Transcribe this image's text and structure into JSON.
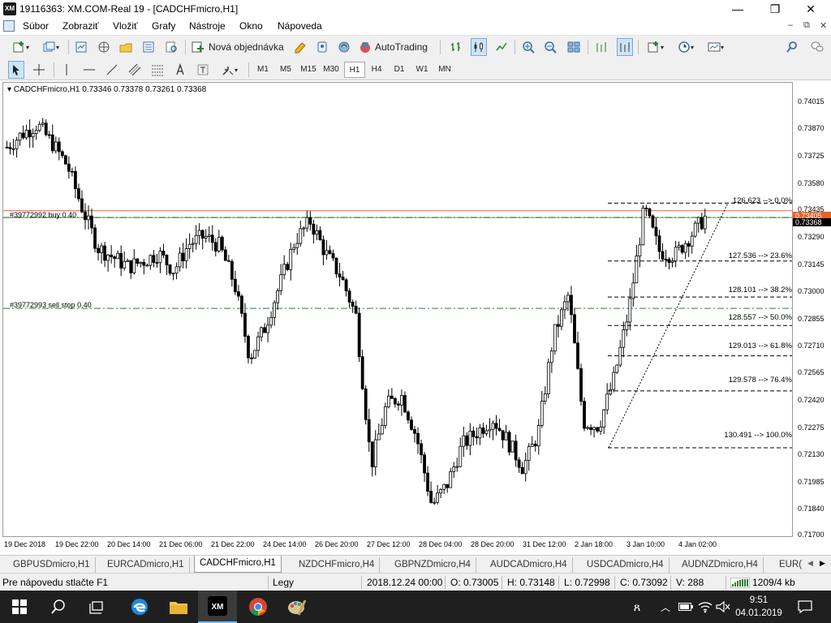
{
  "window": {
    "title": "19116363: XM.COM-Real 19 - [CADCHFmicro,H1]",
    "logo_text": "XM",
    "controls": {
      "minimize": "—",
      "maximize": "❐",
      "close": "✕"
    }
  },
  "menu": {
    "items": [
      "Súbor",
      "Zobraziť",
      "Vložiť",
      "Grafy",
      "Nástroje",
      "Okno",
      "Nápoveda"
    ],
    "mdi_controls": [
      "–",
      "⧉",
      "✕"
    ]
  },
  "toolbar": {
    "new_order_label": "Nová objednávka",
    "autotrading_label": "AutoTrading",
    "icons": [
      "new-chart-icon",
      "profiles-icon",
      "market-watch-icon",
      "navigator-icon",
      "data-window-icon",
      "terminal-icon",
      "strategy-tester-icon",
      "new-order-icon",
      "metaeditor-icon",
      "signals-icon",
      "market-icon",
      "autotrading-icon",
      "bar-chart-icon",
      "candlestick-icon",
      "line-chart-icon",
      "zoom-in-icon",
      "zoom-out-icon",
      "tile-windows-icon",
      "chart-shift-icon",
      "autoscroll-icon",
      "indicators-icon",
      "periods-icon",
      "templates-icon",
      "search-icon",
      "chat-icon"
    ]
  },
  "toolbar2": {
    "tools": [
      "cursor-icon",
      "crosshair-icon",
      "vertical-line-icon",
      "horizontal-line-icon",
      "trendline-icon",
      "equidistant-channel-icon",
      "fibonacci-icon",
      "text-icon",
      "text-label-icon",
      "arrows-icon"
    ],
    "timeframes": [
      "M1",
      "M5",
      "M15",
      "M30",
      "H1",
      "H4",
      "D1",
      "W1",
      "MN"
    ],
    "active_timeframe": "H1"
  },
  "chart": {
    "symbol_info": "CADCHFmicro,H1  0.73346 0.73378 0.73261 0.73368",
    "price_ticks": [
      "0.74015",
      "0.73870",
      "0.73725",
      "0.73580",
      "0.73435",
      "0.73290",
      "0.73145",
      "0.73000",
      "0.72855",
      "0.72710",
      "0.72565",
      "0.72420",
      "0.72275",
      "0.72130",
      "0.71985",
      "0.71840",
      "0.71700"
    ],
    "time_ticks": [
      "19 Dec 2018",
      "19 Dec 22:00",
      "20 Dec 14:00",
      "21 Dec 06:00",
      "21 Dec 22:00",
      "24 Dec 14:00",
      "26 Dec 20:00",
      "27 Dec 12:00",
      "28 Dec 04:00",
      "28 Dec 20:00",
      "31 Dec 12:00",
      "2 Jan 18:00",
      "3 Jan 10:00",
      "4 Jan 02:00"
    ],
    "orders": [
      {
        "label": "#39772992 buy 0.40"
      },
      {
        "label": "#39772993 sell stop 0.40"
      }
    ],
    "price_tags": [
      {
        "text": "0.73405",
        "color": "#e8622c"
      },
      {
        "text": "0.73368",
        "color": "#000000"
      }
    ],
    "fibonacci": [
      "126.623 --> 0.0%",
      "127.536 --> 23.6%",
      "128.101 --> 38.2%",
      "128.557 --> 50.0%",
      "129.013 --> 61.8%",
      "129.578 --> 76.4%",
      "130.491 --> 100.0%"
    ],
    "colors": {
      "order_line": "#2f7d32",
      "bid_line": "#e8622c",
      "candles": "#000000"
    }
  },
  "chart_data": {
    "type": "candlestick",
    "symbol": "CADCHFmicro",
    "timeframe": "H1",
    "last_bar": {
      "open": 0.73346,
      "high": 0.73378,
      "low": 0.73261,
      "close": 0.73368
    },
    "ylim": [
      0.717,
      0.7408
    ],
    "x": [
      "19 Dec 2018",
      "19 Dec 22:00",
      "20 Dec 14:00",
      "21 Dec 06:00",
      "21 Dec 22:00",
      "24 Dec 14:00",
      "26 Dec 20:00",
      "27 Dec 12:00",
      "28 Dec 04:00",
      "28 Dec 20:00",
      "31 Dec 12:00",
      "2 Jan 18:00",
      "3 Jan 10:00",
      "4 Jan 02:00"
    ],
    "close_path": [
      0.7374,
      0.7381,
      0.7386,
      0.7376,
      0.7364,
      0.7341,
      0.7321,
      0.7316,
      0.7311,
      0.7314,
      0.7318,
      0.7309,
      0.7323,
      0.7327,
      0.7322,
      0.7302,
      0.7263,
      0.7279,
      0.7302,
      0.7325,
      0.7335,
      0.7318,
      0.7306,
      0.7285,
      0.7206,
      0.7238,
      0.7243,
      0.7221,
      0.7185,
      0.7196,
      0.7217,
      0.7224,
      0.7231,
      0.7219,
      0.7205,
      0.7223,
      0.7274,
      0.7296,
      0.7229,
      0.7227,
      0.7252,
      0.7289,
      0.7342,
      0.7319,
      0.7317,
      0.7327,
      0.7337
    ],
    "grid": false
  },
  "tabs": {
    "items": [
      "GBPUSDmicro,H1",
      "EURCADmicro,H1",
      "CADCHFmicro,H1",
      "NZDCHFmicro,H4",
      "GBPNZDmicro,H4",
      "AUDCADmicro,H4",
      "USDCADmicro,H4",
      "AUDNZDmicro,H4",
      "EUR("
    ],
    "active": "CADCHFmicro,H1"
  },
  "status": {
    "help": "Pre nápovedu stlačte F1",
    "profile": "Legy",
    "datetime": "2018.12.24 00:00",
    "open": "O: 0.73005",
    "high": "H: 0.73148",
    "low": "L: 0.72998",
    "close": "C: 0.73092",
    "volume": "V: 288",
    "traffic": "1209/4 kb"
  },
  "taskbar": {
    "icons": [
      "windows-start-icon",
      "search-icon",
      "task-view-icon",
      "edge-icon",
      "file-explorer-icon",
      "mt4-icon",
      "chrome-icon",
      "paint-icon"
    ],
    "time": "9:51",
    "date": "04.01.2019"
  }
}
